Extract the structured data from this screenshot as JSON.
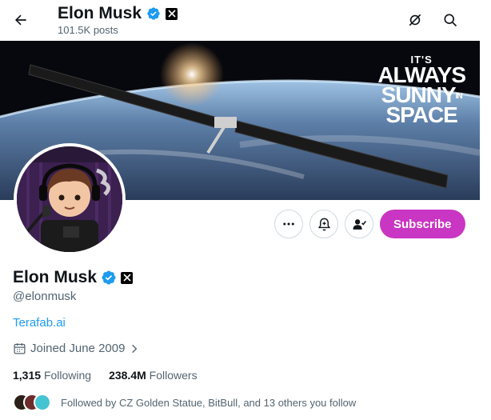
{
  "header": {
    "name": "Elon Musk",
    "posts_count": "101.5K posts"
  },
  "banner": {
    "line1": "IT'S",
    "line2": "ALWAYS",
    "line3": "SUNNY",
    "line3_small": "IN",
    "line4": "SPACE"
  },
  "actions": {
    "subscribe_label": "Subscribe"
  },
  "profile": {
    "display_name": "Elon Musk",
    "handle": "@elonmusk",
    "website": "Terafab.ai",
    "joined": "Joined June 2009"
  },
  "stats": {
    "following_count": "1,315",
    "following_label": "Following",
    "followers_count": "238.4M",
    "followers_label": "Followers"
  },
  "followed_by": {
    "text": "Followed by CZ Golden Statue, BitBull, and 13 others you follow"
  },
  "colors": {
    "accent_blue": "#1d9bf0",
    "subscribe": "#c936c3",
    "muted_text": "#536471"
  },
  "icons": {
    "back": "arrow-left-icon",
    "grok": "grok-icon",
    "search": "search-icon",
    "more": "more-dots-icon",
    "notify": "bell-add-icon",
    "follow": "person-check-icon",
    "calendar": "calendar-icon",
    "chevron": "chevron-right-icon"
  }
}
